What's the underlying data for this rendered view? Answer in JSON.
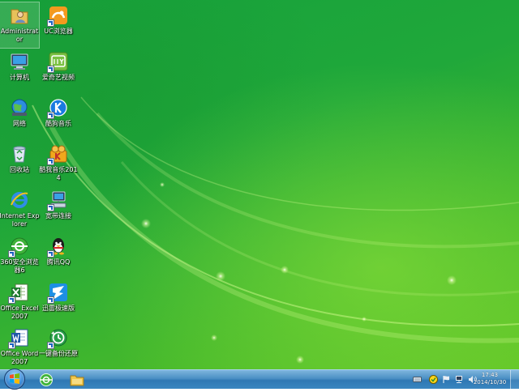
{
  "desktop": {
    "icons": [
      {
        "label": "Administrator",
        "icon": "user-folder-icon"
      },
      {
        "label": "UC浏览器",
        "icon": "uc-browser-icon"
      },
      {
        "label": "计算机",
        "icon": "computer-icon"
      },
      {
        "label": "爱奇艺视频",
        "icon": "iqiyi-icon"
      },
      {
        "label": "网络",
        "icon": "network-icon"
      },
      {
        "label": "酷狗音乐",
        "icon": "kugou-icon"
      },
      {
        "label": "回收站",
        "icon": "recycle-bin-icon"
      },
      {
        "label": "酷我音乐2014",
        "icon": "kuwo-icon"
      },
      {
        "label": "Internet Explorer",
        "icon": "internet-explorer-icon"
      },
      {
        "label": "宽带连接",
        "icon": "broadband-icon"
      },
      {
        "label": "360安全浏览器6",
        "icon": "360-browser-icon"
      },
      {
        "label": "腾讯QQ",
        "icon": "qq-icon"
      },
      {
        "label": "Office Excel 2007",
        "icon": "excel-icon"
      },
      {
        "label": "迅雷极速版",
        "icon": "thunder-icon"
      },
      {
        "label": "Office Word 2007",
        "icon": "word-icon"
      },
      {
        "label": "一键备份还原",
        "icon": "backup-restore-icon"
      }
    ]
  },
  "taskbar": {
    "start_icon": "windows-logo-icon",
    "pinned": [
      {
        "icon": "360-browser-icon"
      },
      {
        "icon": "file-explorer-icon"
      }
    ],
    "tray": [
      {
        "icon": "keyboard-icon"
      },
      {
        "icon": "360-guard-icon"
      },
      {
        "icon": "flag-icon"
      },
      {
        "icon": "network-tray-icon"
      },
      {
        "icon": "volume-icon"
      }
    ],
    "clock": {
      "time": "17:43",
      "date": "2014/10/30"
    }
  },
  "colors": {
    "desktop_green": "#20a83a",
    "taskbar_blue": "#4b8fc4"
  }
}
